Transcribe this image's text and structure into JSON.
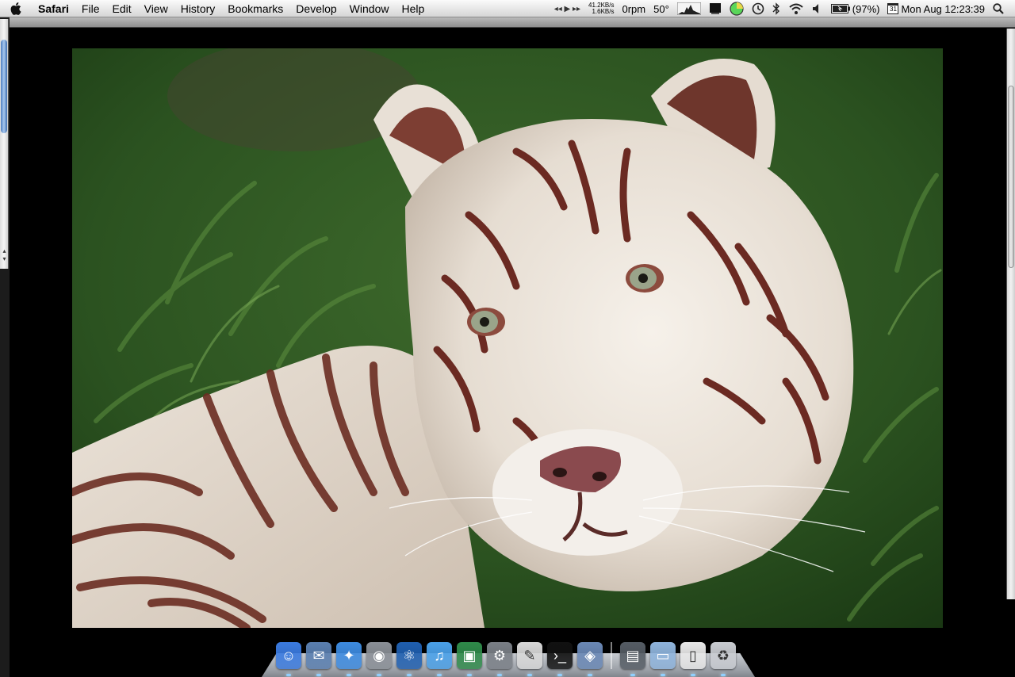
{
  "menubar": {
    "apple_icon": "apple-logo-icon",
    "app_name": "Safari",
    "menus": [
      "File",
      "Edit",
      "View",
      "History",
      "Bookmarks",
      "Develop",
      "Window",
      "Help"
    ],
    "status": {
      "media_controls": "◂◂ ▶ ▸▸",
      "net_up": "41.2KB/s",
      "net_down": "1.6KB/s",
      "fan": "0rpm",
      "temp": "50°",
      "battery_percent": "(97%)",
      "calendar_day": "31",
      "clock": "Mon Aug 12:23:39"
    }
  },
  "photo": {
    "subject_icon": "white-tiger-photo"
  },
  "dock": {
    "items": [
      {
        "name": "finder",
        "glyph": "☺",
        "color": "#3b7be0"
      },
      {
        "name": "mail",
        "glyph": "✉",
        "color": "#5a7fb0"
      },
      {
        "name": "safari",
        "glyph": "✦",
        "color": "#3d8be0"
      },
      {
        "name": "disk-utility",
        "glyph": "◉",
        "color": "#8a8f96"
      },
      {
        "name": "network",
        "glyph": "⚛",
        "color": "#1f5fb0"
      },
      {
        "name": "itunes",
        "glyph": "♫",
        "color": "#4aa0e8"
      },
      {
        "name": "photo-booth",
        "glyph": "▣",
        "color": "#2f8a4a"
      },
      {
        "name": "system-preferences",
        "glyph": "⚙",
        "color": "#7a7f86"
      },
      {
        "name": "text-edit",
        "glyph": "✎",
        "color": "#d8d8d8"
      },
      {
        "name": "terminal",
        "glyph": "›_",
        "color": "#111111"
      },
      {
        "name": "preview",
        "glyph": "◈",
        "color": "#6a88b5"
      }
    ],
    "stacks": [
      {
        "name": "image-stack",
        "glyph": "▤",
        "color": "#555c64"
      },
      {
        "name": "folder-stack",
        "glyph": "▭",
        "color": "#8fb4dc"
      },
      {
        "name": "documents-stack",
        "glyph": "▯",
        "color": "#e8e8e8"
      },
      {
        "name": "trash",
        "glyph": "♻",
        "color": "#c9ccd1"
      }
    ]
  }
}
